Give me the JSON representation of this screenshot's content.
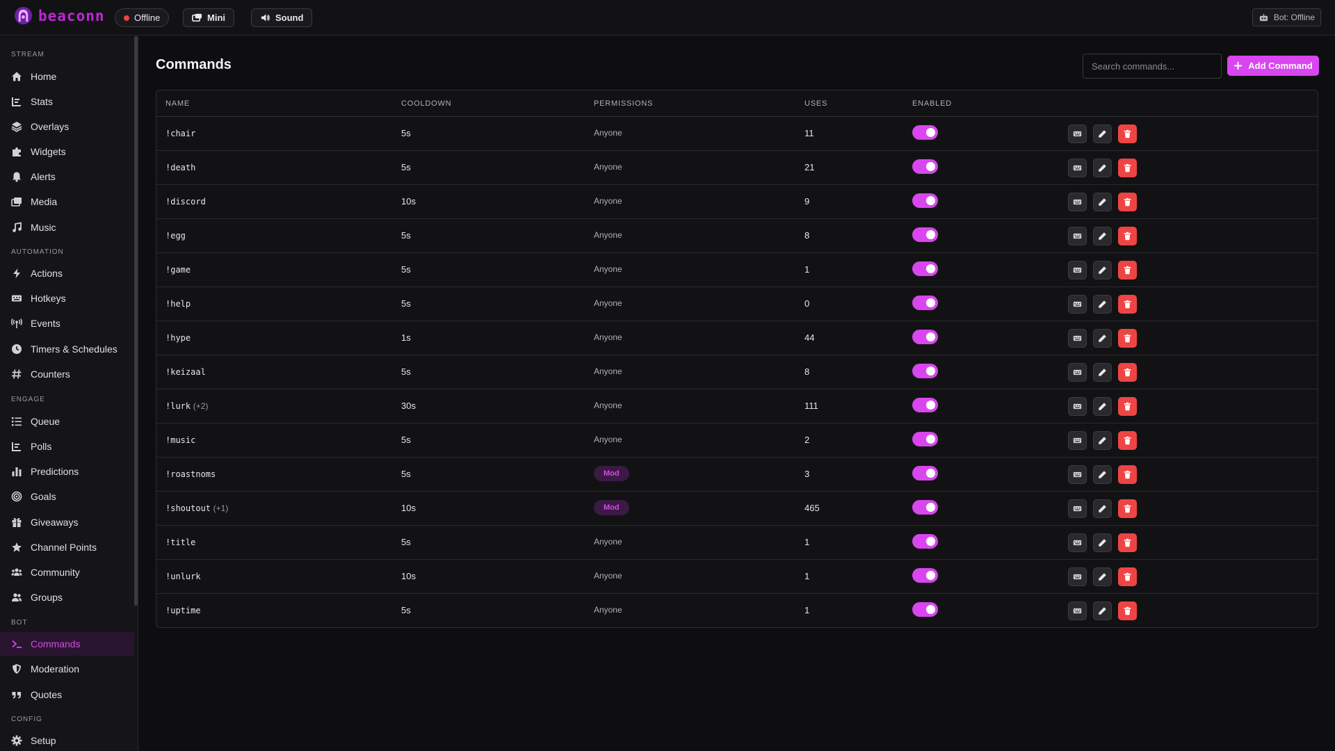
{
  "app": {
    "name": "beaconn"
  },
  "topbar": {
    "status_label": "Offline",
    "mini_label": "Mini",
    "sound_label": "Sound",
    "bot_status": "Bot: Offline"
  },
  "sidebar": {
    "sections": [
      {
        "title": "STREAM",
        "items": [
          {
            "label": "Home",
            "icon": "home-icon"
          },
          {
            "label": "Stats",
            "icon": "chart-icon"
          },
          {
            "label": "Overlays",
            "icon": "layers-icon"
          },
          {
            "label": "Widgets",
            "icon": "puzzle-icon"
          },
          {
            "label": "Alerts",
            "icon": "bell-icon"
          },
          {
            "label": "Media",
            "icon": "images-icon"
          },
          {
            "label": "Music",
            "icon": "music-icon"
          }
        ]
      },
      {
        "title": "AUTOMATION",
        "items": [
          {
            "label": "Actions",
            "icon": "bolt-icon"
          },
          {
            "label": "Hotkeys",
            "icon": "keyboard-icon"
          },
          {
            "label": "Events",
            "icon": "broadcast-icon"
          },
          {
            "label": "Timers & Schedules",
            "icon": "clock-icon"
          },
          {
            "label": "Counters",
            "icon": "hash-icon"
          }
        ]
      },
      {
        "title": "ENGAGE",
        "items": [
          {
            "label": "Queue",
            "icon": "list-icon"
          },
          {
            "label": "Polls",
            "icon": "chart-icon"
          },
          {
            "label": "Predictions",
            "icon": "bar-chart-icon"
          },
          {
            "label": "Goals",
            "icon": "target-icon"
          },
          {
            "label": "Giveaways",
            "icon": "gift-icon"
          },
          {
            "label": "Channel Points",
            "icon": "star-icon"
          },
          {
            "label": "Community",
            "icon": "users-icon"
          },
          {
            "label": "Groups",
            "icon": "user-group-icon"
          }
        ]
      },
      {
        "title": "BOT",
        "items": [
          {
            "label": "Commands",
            "icon": "terminal-icon",
            "active": true
          },
          {
            "label": "Moderation",
            "icon": "shield-icon"
          },
          {
            "label": "Quotes",
            "icon": "quote-icon"
          }
        ]
      },
      {
        "title": "CONFIG",
        "items": [
          {
            "label": "Setup",
            "icon": "gear-icon"
          }
        ]
      }
    ]
  },
  "main": {
    "title": "Commands",
    "search_placeholder": "Search commands...",
    "add_label": "Add Command",
    "columns": [
      "NAME",
      "COOLDOWN",
      "PERMISSIONS",
      "USES",
      "ENABLED"
    ],
    "rows": [
      {
        "name": "!chair",
        "alias": "",
        "cooldown": "5s",
        "permission": "Anyone",
        "uses": "11",
        "enabled": true
      },
      {
        "name": "!death",
        "alias": "",
        "cooldown": "5s",
        "permission": "Anyone",
        "uses": "21",
        "enabled": true
      },
      {
        "name": "!discord",
        "alias": "",
        "cooldown": "10s",
        "permission": "Anyone",
        "uses": "9",
        "enabled": true
      },
      {
        "name": "!egg",
        "alias": "",
        "cooldown": "5s",
        "permission": "Anyone",
        "uses": "8",
        "enabled": true
      },
      {
        "name": "!game",
        "alias": "",
        "cooldown": "5s",
        "permission": "Anyone",
        "uses": "1",
        "enabled": true
      },
      {
        "name": "!help",
        "alias": "",
        "cooldown": "5s",
        "permission": "Anyone",
        "uses": "0",
        "enabled": true
      },
      {
        "name": "!hype",
        "alias": "",
        "cooldown": "1s",
        "permission": "Anyone",
        "uses": "44",
        "enabled": true
      },
      {
        "name": "!keizaal",
        "alias": "",
        "cooldown": "5s",
        "permission": "Anyone",
        "uses": "8",
        "enabled": true
      },
      {
        "name": "!lurk",
        "alias": "(+2)",
        "cooldown": "30s",
        "permission": "Anyone",
        "uses": "111",
        "enabled": true
      },
      {
        "name": "!music",
        "alias": "",
        "cooldown": "5s",
        "permission": "Anyone",
        "uses": "2",
        "enabled": true
      },
      {
        "name": "!roastnoms",
        "alias": "",
        "cooldown": "5s",
        "permission": "Mod",
        "uses": "3",
        "enabled": true
      },
      {
        "name": "!shoutout",
        "alias": "(+1)",
        "cooldown": "10s",
        "permission": "Mod",
        "uses": "465",
        "enabled": true
      },
      {
        "name": "!title",
        "alias": "",
        "cooldown": "5s",
        "permission": "Anyone",
        "uses": "1",
        "enabled": true
      },
      {
        "name": "!unlurk",
        "alias": "",
        "cooldown": "10s",
        "permission": "Anyone",
        "uses": "1",
        "enabled": true
      },
      {
        "name": "!uptime",
        "alias": "",
        "cooldown": "5s",
        "permission": "Anyone",
        "uses": "1",
        "enabled": true
      }
    ]
  },
  "colors": {
    "accent": "#d946ef",
    "danger": "#ef4444",
    "background": "#0e0e10"
  }
}
